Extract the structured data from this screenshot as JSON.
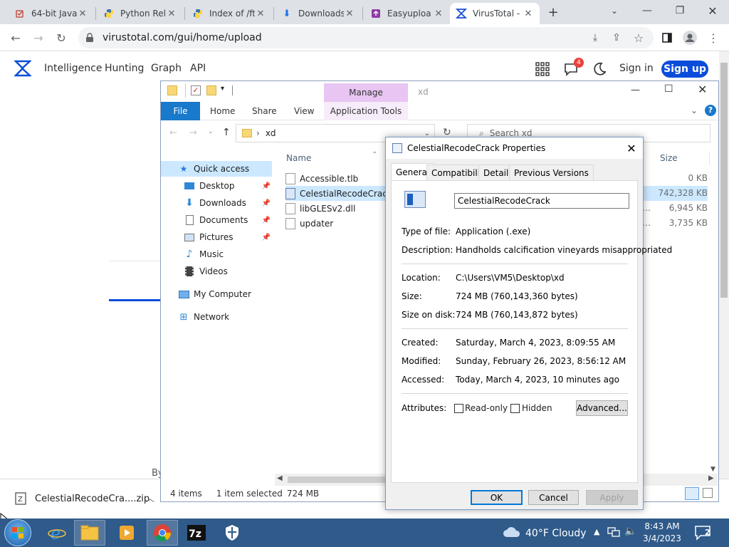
{
  "browser": {
    "tabs": [
      {
        "title": "64-bit Java",
        "icon": "java-icon"
      },
      {
        "title": "Python Rele",
        "icon": "python-icon"
      },
      {
        "title": "Index of /ft",
        "icon": "python-icon"
      },
      {
        "title": "Downloads",
        "icon": "download-icon"
      },
      {
        "title": "Easyuploa",
        "icon": "easyupload-icon"
      },
      {
        "title": "VirusTotal -",
        "icon": "virustotal-icon"
      }
    ],
    "url": "virustotal.com/gui/home/upload"
  },
  "vt": {
    "nav": [
      "Intelligence",
      "Hunting",
      "Graph",
      "API"
    ],
    "notif_count": "4",
    "signin": "Sign in",
    "signup": "Sign up",
    "by_text": "By"
  },
  "explorer": {
    "title": "xd",
    "manage": "Manage",
    "ribbon": {
      "file": "File",
      "home": "Home",
      "share": "Share",
      "view": "View",
      "app_tools": "Application Tools"
    },
    "address": "xd",
    "search_placeholder": "Search xd",
    "nav": [
      {
        "label": "Quick access",
        "icon": "star-icon",
        "pinned": false
      },
      {
        "label": "Desktop",
        "icon": "desktop-icon",
        "pinned": true
      },
      {
        "label": "Downloads",
        "icon": "download-icon",
        "pinned": true
      },
      {
        "label": "Documents",
        "icon": "documents-icon",
        "pinned": true
      },
      {
        "label": "Pictures",
        "icon": "pictures-icon",
        "pinned": true
      },
      {
        "label": "Music",
        "icon": "music-icon",
        "pinned": false
      },
      {
        "label": "Videos",
        "icon": "videos-icon",
        "pinned": false
      },
      {
        "label": "My Computer",
        "icon": "computer-icon",
        "pinned": false
      },
      {
        "label": "Network",
        "icon": "network-icon",
        "pinned": false
      }
    ],
    "columns": {
      "name": "Name",
      "size": "Size"
    },
    "files": [
      {
        "name": "Accessible.tlb",
        "size": "0 KB"
      },
      {
        "name": "CelestialRecodeCrack",
        "size": "742,328 KB"
      },
      {
        "name": "libGLESv2.dll",
        "size": "6,945 KB"
      },
      {
        "name": "updater",
        "size": "3,735 KB"
      }
    ],
    "status": {
      "count": "4 items",
      "selected": "1 item selected",
      "size": "724 MB"
    }
  },
  "dialog": {
    "title": "CelestialRecodeCrack Properties",
    "tabs": [
      "General",
      "Compatibility",
      "Details",
      "Previous Versions"
    ],
    "filename": "CelestialRecodeCrack",
    "labels": {
      "type": "Type of file:",
      "description": "Description:",
      "location": "Location:",
      "size": "Size:",
      "size_on_disk": "Size on disk:",
      "created": "Created:",
      "modified": "Modified:",
      "accessed": "Accessed:",
      "attributes": "Attributes:"
    },
    "values": {
      "type": "Application (.exe)",
      "description": "Handholds calcification vineyards misappropriated",
      "location": "C:\\Users\\VM5\\Desktop\\xd",
      "size": "724 MB (760,143,360 bytes)",
      "size_on_disk": "724 MB (760,143,872 bytes)",
      "created": "Saturday, March 4, 2023, 8:09:55 AM",
      "modified": "Sunday, February 26, 2023, 8:56:12 AM",
      "accessed": "Today, March 4, 2023, 10 minutes ago"
    },
    "readonly": "Read-only",
    "hidden": "Hidden",
    "advanced": "Advanced...",
    "ok": "OK",
    "cancel": "Cancel",
    "apply": "Apply"
  },
  "download": {
    "filename": "CelestialRecodeCra....zip"
  },
  "taskbar": {
    "weather": "40°F  Cloudy",
    "time": "8:43 AM",
    "date": "3/4/2023",
    "notifications": "2"
  }
}
